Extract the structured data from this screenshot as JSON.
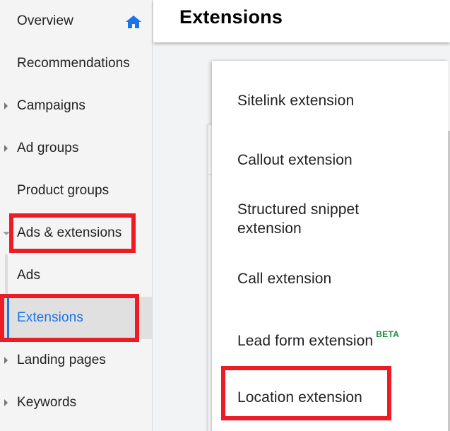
{
  "sidebar": {
    "items": [
      {
        "label": "Overview",
        "icon": "home-icon",
        "expandable": false
      },
      {
        "label": "Recommendations",
        "expandable": false
      },
      {
        "label": "Campaigns",
        "expandable": true,
        "expanded": false
      },
      {
        "label": "Ad groups",
        "expandable": true,
        "expanded": false
      },
      {
        "label": "Product groups",
        "expandable": false
      },
      {
        "label": "Ads & extensions",
        "expandable": true,
        "expanded": true,
        "highlighted": true
      },
      {
        "label": "Ads",
        "sub": true
      },
      {
        "label": "Extensions",
        "sub": true,
        "active": true,
        "highlighted": true
      },
      {
        "label": "Landing pages",
        "expandable": true,
        "expanded": false
      },
      {
        "label": "Keywords",
        "expandable": true,
        "expanded": false
      }
    ]
  },
  "header": {
    "title": "Extensions"
  },
  "menu": {
    "items": [
      {
        "label": "Sitelink extension"
      },
      {
        "label": "Callout extension"
      },
      {
        "label": "Structured snippet extension"
      },
      {
        "label": "Call extension"
      },
      {
        "label": "Lead form extension",
        "badge": "BETA"
      },
      {
        "label": "Location extension",
        "highlighted": true
      }
    ]
  },
  "colors": {
    "accent": "#1a73e8",
    "highlight": "#ed1c24",
    "beta": "#1e8e3e"
  }
}
